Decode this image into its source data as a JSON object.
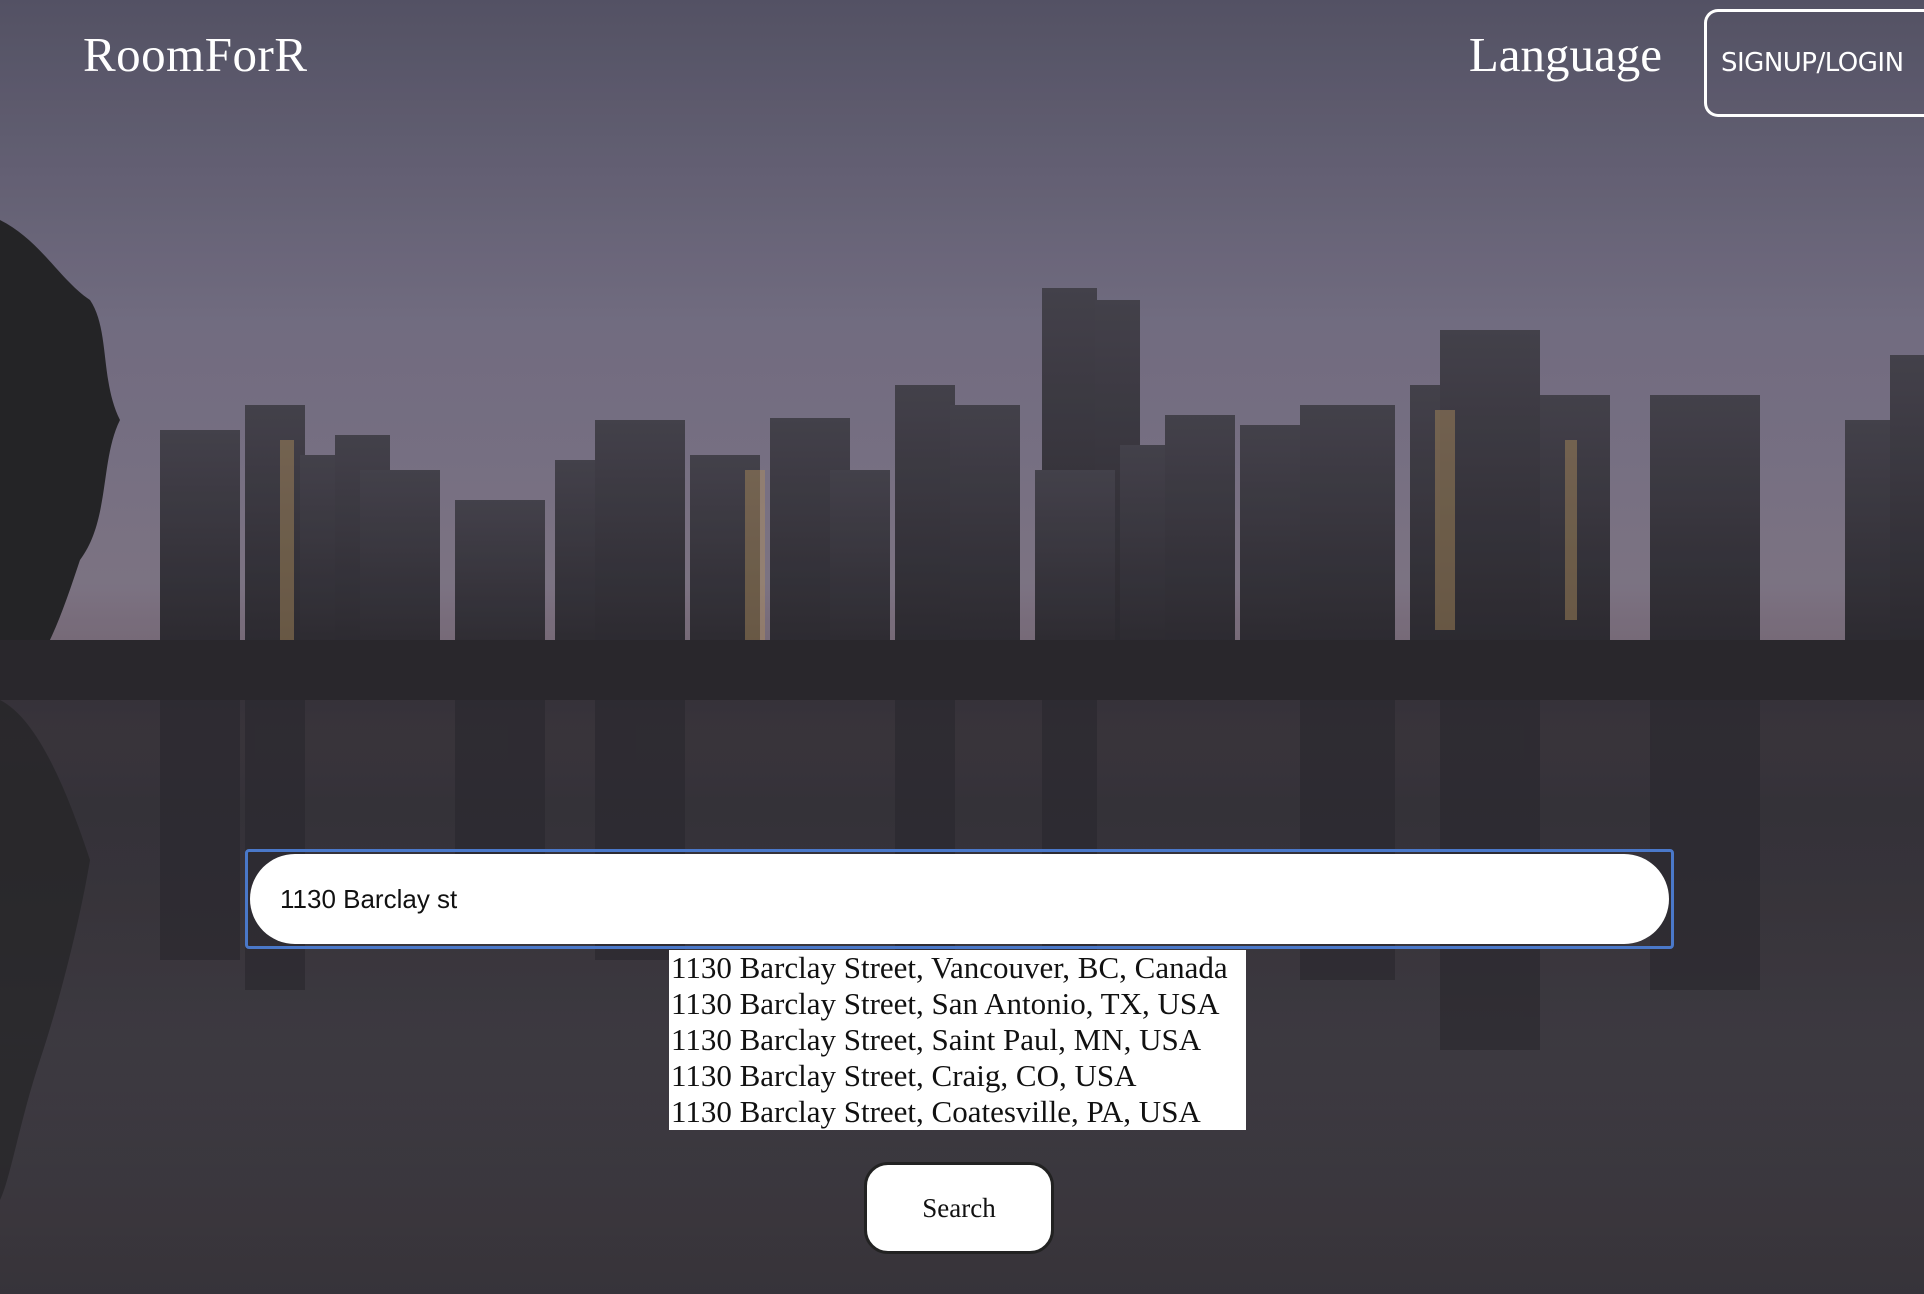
{
  "header": {
    "brand": "RoomForR",
    "language_label": "Language",
    "auth_label": "SIGNUP/LOGIN"
  },
  "search": {
    "value": "1130 Barclay st",
    "button_label": "Search",
    "suggestions": [
      "1130 Barclay Street, Vancouver, BC, Canada",
      "1130 Barclay Street, San Antonio, TX, USA",
      "1130 Barclay Street, Saint Paul, MN, USA",
      "1130 Barclay Street, Craig, CO, USA",
      "1130 Barclay Street, Coatesville, PA, USA"
    ]
  },
  "colors": {
    "focus_ring": "#4a78c9",
    "sky_top": "#5f5d72",
    "sky_mid": "#8a8498",
    "water": "#3f3c42"
  }
}
